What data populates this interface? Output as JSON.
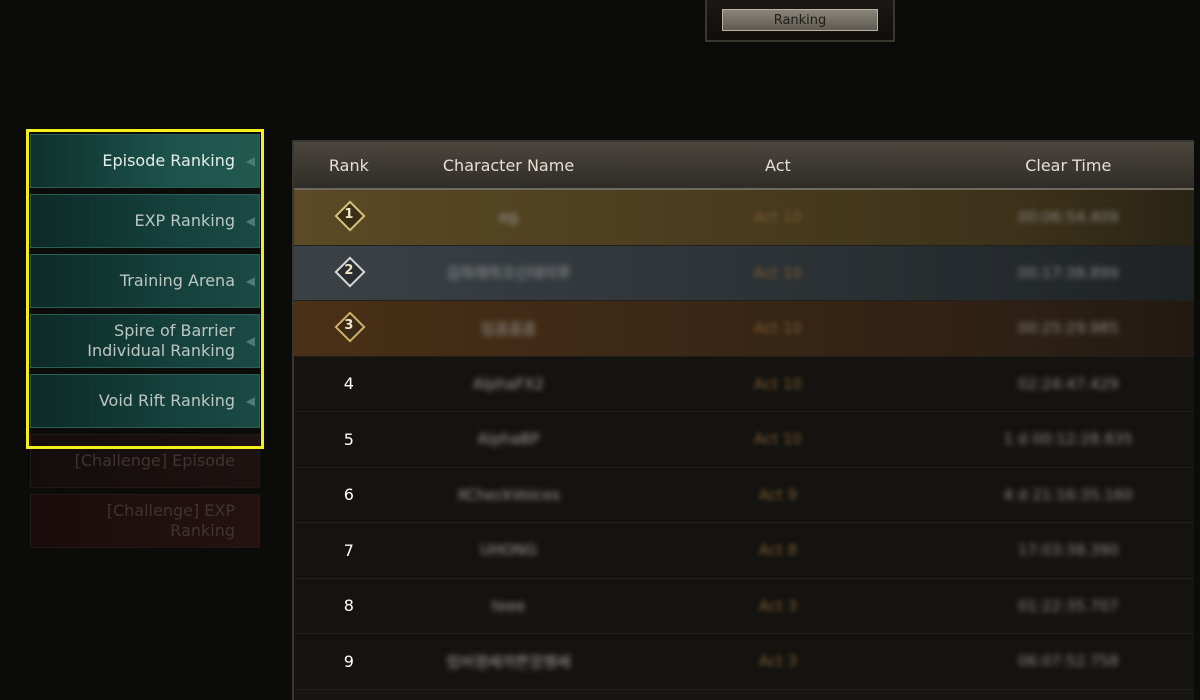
{
  "header": {
    "title": "Ranking"
  },
  "menu": {
    "items": [
      {
        "label": "Episode Ranking"
      },
      {
        "label": "EXP Ranking"
      },
      {
        "label": "Training Arena"
      },
      {
        "label": "Spire of Barrier Individual Ranking"
      },
      {
        "label": "Void Rift Ranking"
      },
      {
        "label": "[Challenge] Episode"
      },
      {
        "label": "[Challenge] EXP Ranking"
      }
    ]
  },
  "table": {
    "columns": [
      "Rank",
      "Character Name",
      "Act",
      "Clear Time"
    ],
    "rows": [
      {
        "rank": "1",
        "name": "eg",
        "act": "Act 10",
        "time": "00:06:54.409",
        "style": "gold"
      },
      {
        "rank": "2",
        "name": "김하래하꼬신데이루",
        "act": "Act 10",
        "time": "00:17:38.899",
        "style": "silver"
      },
      {
        "rank": "3",
        "name": "임꼼꼼꼼",
        "act": "Act 10",
        "time": "00:25:29.985",
        "style": "bronze"
      },
      {
        "rank": "4",
        "name": "AlphaFX2",
        "act": "Act 10",
        "time": "02:24:47.429",
        "style": "plain"
      },
      {
        "rank": "5",
        "name": "AlphaBP",
        "act": "Act 10",
        "time": "1 d 00:12:28.835",
        "style": "plain"
      },
      {
        "rank": "6",
        "name": "XCheckVoices",
        "act": "Act 9",
        "time": "4 d 21:16:35.160",
        "style": "plain"
      },
      {
        "rank": "7",
        "name": "UHONG",
        "act": "Act 8",
        "time": "17:03:38.390",
        "style": "plain"
      },
      {
        "rank": "8",
        "name": "teee",
        "act": "Act 3",
        "time": "01:22:35.707",
        "style": "plain"
      },
      {
        "rank": "9",
        "name": "럼버잼쎄꺄쁜깜쨍쎄",
        "act": "Act 3",
        "time": "06:07:52.758",
        "style": "plain"
      }
    ]
  }
}
